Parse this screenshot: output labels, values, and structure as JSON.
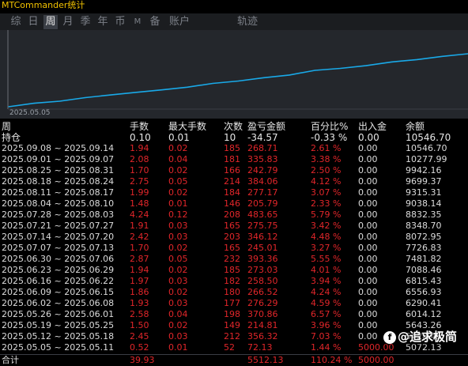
{
  "app": {
    "title": "MTCommander统计"
  },
  "tabs": [
    {
      "label": "综"
    },
    {
      "label": "日"
    },
    {
      "label": "周"
    },
    {
      "label": "月"
    },
    {
      "label": "季"
    },
    {
      "label": "年"
    },
    {
      "label": "币"
    },
    {
      "label": "M"
    },
    {
      "label": "备"
    },
    {
      "label": "账户"
    },
    {
      "label": "轨迹"
    }
  ],
  "active_tab": "周",
  "chart": {
    "date_label": "2025.05.05"
  },
  "chart_data": {
    "type": "line",
    "x": [
      "2025.05.05",
      "2025.05.12",
      "2025.05.19",
      "2025.05.26",
      "2025.06.02",
      "2025.06.09",
      "2025.06.16",
      "2025.06.23",
      "2025.06.30",
      "2025.07.07",
      "2025.07.14",
      "2025.07.21",
      "2025.07.28",
      "2025.08.04",
      "2025.08.11",
      "2025.08.18",
      "2025.08.25",
      "2025.09.01",
      "2025.09.08"
    ],
    "y": [
      5072.13,
      5428.45,
      5643.26,
      6014.12,
      6290.41,
      6556.93,
      6815.43,
      7088.46,
      7481.82,
      7726.83,
      8072.95,
      8348.7,
      8832.35,
      9038.14,
      9315.31,
      9699.37,
      9942.16,
      10277.99,
      10546.7
    ],
    "line_color": "#19a9e8"
  },
  "table": {
    "headers": [
      "周",
      "手数",
      "最大手数",
      "次数",
      "盈亏金额",
      "百分比%",
      "出入金",
      "余额"
    ],
    "holding": {
      "label": "持仓",
      "lots": "0.10",
      "max_lots": "0.01",
      "count": "10",
      "pnl": "-34.57",
      "pct": "-0.33 %",
      "io": "0.00",
      "balance": "10546.70"
    },
    "rows": [
      {
        "week": "2025.09.08 ~ 2025.09.14",
        "lots": "1.94",
        "max_lots": "0.02",
        "count": "185",
        "pnl": "268.71",
        "pct": "2.61 %",
        "io": "0.00",
        "balance": "10546.70"
      },
      {
        "week": "2025.09.01 ~ 2025.09.07",
        "lots": "2.08",
        "max_lots": "0.04",
        "count": "181",
        "pnl": "335.83",
        "pct": "3.38 %",
        "io": "0.00",
        "balance": "10277.99"
      },
      {
        "week": "2025.08.25 ~ 2025.08.31",
        "lots": "1.70",
        "max_lots": "0.02",
        "count": "166",
        "pnl": "242.79",
        "pct": "2.50 %",
        "io": "0.00",
        "balance": "9942.16"
      },
      {
        "week": "2025.08.18 ~ 2025.08.24",
        "lots": "2.75",
        "max_lots": "0.05",
        "count": "214",
        "pnl": "384.06",
        "pct": "4.12 %",
        "io": "0.00",
        "balance": "9699.37"
      },
      {
        "week": "2025.08.11 ~ 2025.08.17",
        "lots": "1.99",
        "max_lots": "0.02",
        "count": "184",
        "pnl": "277.17",
        "pct": "3.07 %",
        "io": "0.00",
        "balance": "9315.31"
      },
      {
        "week": "2025.08.04 ~ 2025.08.10",
        "lots": "1.48",
        "max_lots": "0.01",
        "count": "146",
        "pnl": "205.79",
        "pct": "2.33 %",
        "io": "0.00",
        "balance": "9038.14"
      },
      {
        "week": "2025.07.28 ~ 2025.08.03",
        "lots": "4.24",
        "max_lots": "0.12",
        "count": "208",
        "pnl": "483.65",
        "pct": "5.79 %",
        "io": "0.00",
        "balance": "8832.35"
      },
      {
        "week": "2025.07.21 ~ 2025.07.27",
        "lots": "1.91",
        "max_lots": "0.03",
        "count": "165",
        "pnl": "275.75",
        "pct": "3.42 %",
        "io": "0.00",
        "balance": "8348.70"
      },
      {
        "week": "2025.07.14 ~ 2025.07.20",
        "lots": "2.42",
        "max_lots": "0.03",
        "count": "203",
        "pnl": "346.12",
        "pct": "4.48 %",
        "io": "0.00",
        "balance": "8072.95"
      },
      {
        "week": "2025.07.07 ~ 2025.07.13",
        "lots": "1.70",
        "max_lots": "0.02",
        "count": "165",
        "pnl": "245.01",
        "pct": "3.27 %",
        "io": "0.00",
        "balance": "7726.83"
      },
      {
        "week": "2025.06.30 ~ 2025.07.06",
        "lots": "2.87",
        "max_lots": "0.05",
        "count": "232",
        "pnl": "393.36",
        "pct": "5.55 %",
        "io": "0.00",
        "balance": "7481.82"
      },
      {
        "week": "2025.06.23 ~ 2025.06.29",
        "lots": "1.94",
        "max_lots": "0.02",
        "count": "185",
        "pnl": "273.03",
        "pct": "4.01 %",
        "io": "0.00",
        "balance": "7088.46"
      },
      {
        "week": "2025.06.16 ~ 2025.06.22",
        "lots": "1.97",
        "max_lots": "0.03",
        "count": "182",
        "pnl": "258.50",
        "pct": "3.94 %",
        "io": "0.00",
        "balance": "6815.43"
      },
      {
        "week": "2025.06.09 ~ 2025.06.15",
        "lots": "1.86",
        "max_lots": "0.02",
        "count": "180",
        "pnl": "266.52",
        "pct": "4.24 %",
        "io": "0.00",
        "balance": "6556.93"
      },
      {
        "week": "2025.06.02 ~ 2025.06.08",
        "lots": "1.93",
        "max_lots": "0.03",
        "count": "177",
        "pnl": "276.29",
        "pct": "4.59 %",
        "io": "0.00",
        "balance": "6290.41"
      },
      {
        "week": "2025.05.26 ~ 2025.06.01",
        "lots": "2.58",
        "max_lots": "0.04",
        "count": "198",
        "pnl": "370.86",
        "pct": "6.57 %",
        "io": "0.00",
        "balance": "6014.12"
      },
      {
        "week": "2025.05.19 ~ 2025.05.25",
        "lots": "1.50",
        "max_lots": "0.02",
        "count": "149",
        "pnl": "214.81",
        "pct": "3.96 %",
        "io": "0.00",
        "balance": "5643.26"
      },
      {
        "week": "2025.05.12 ~ 2025.05.18",
        "lots": "2.45",
        "max_lots": "0.03",
        "count": "212",
        "pnl": "356.32",
        "pct": "7.03 %",
        "io": "0.00",
        "balance": "5428.45"
      },
      {
        "week": "2025.05.05 ~ 2025.05.11",
        "lots": "0.52",
        "max_lots": "0.01",
        "count": "52",
        "pnl": "72.13",
        "pct": "1.44 %",
        "io": "5000.00",
        "balance": "5072.13"
      }
    ],
    "total": {
      "label": "合计",
      "lots": "39.93",
      "pnl": "5512.13",
      "pct": "110.24 %",
      "io": "5000.00"
    }
  },
  "watermark": {
    "logo": "f",
    "text": "@追求极简"
  },
  "colors": {
    "title": "#f2c200",
    "line": "#19a9e8",
    "positive": "#e1262a",
    "holding": "#27d35a"
  }
}
